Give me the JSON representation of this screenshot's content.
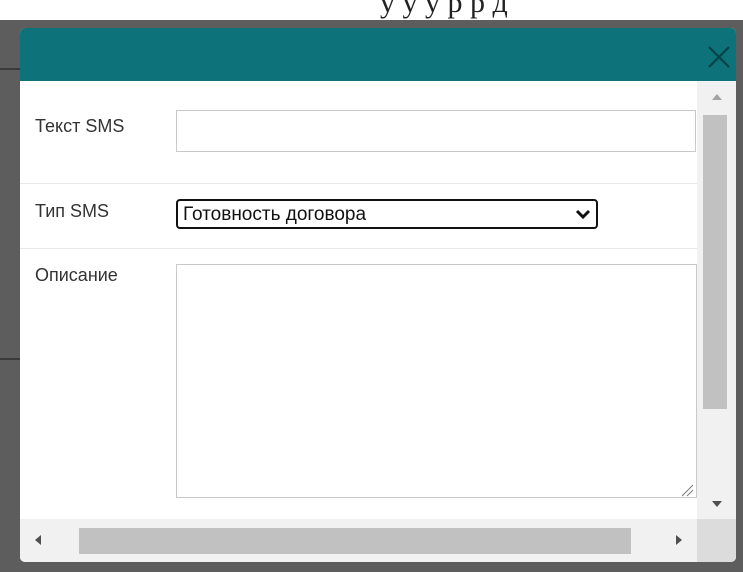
{
  "background": {
    "partial_text": "у у у р р д"
  },
  "dialog": {
    "title": "",
    "accent_color": "#0d727a",
    "close_icon": "close-icon"
  },
  "form": {
    "sms_text": {
      "label": "Текст SMS",
      "value": "",
      "placeholder": ""
    },
    "sms_type": {
      "label": "Тип SMS",
      "selected": "Готовность договора",
      "icon": "chevron-down-icon"
    },
    "description": {
      "label": "Описание",
      "value": ""
    }
  },
  "scrollbars": {
    "vertical": true,
    "horizontal": true
  }
}
